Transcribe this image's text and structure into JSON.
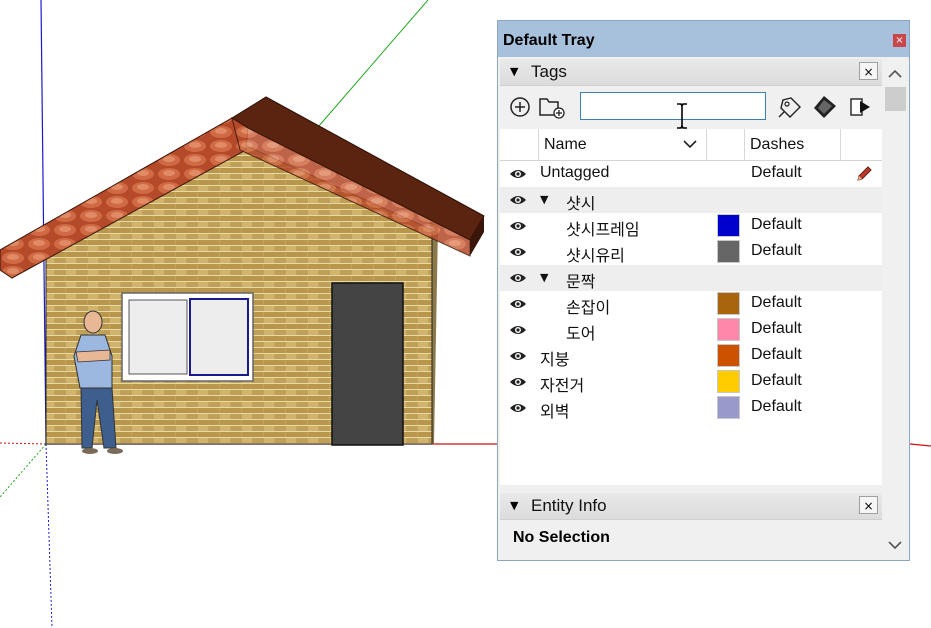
{
  "tray": {
    "title": "Default Tray",
    "close_glyph": "×"
  },
  "tags_panel": {
    "label": "Tags",
    "collapse_glyph": "▼",
    "close_glyph": "×",
    "search": {
      "value": "",
      "placeholder": ""
    },
    "toolbar_icons": [
      "add-tag-icon",
      "add-folder-icon",
      "tag-tool-icon",
      "color-by-tag-icon",
      "details-arrow-icon"
    ],
    "columns": {
      "name": "Name",
      "dashes": "Dashes"
    },
    "rows": [
      {
        "type": "tag",
        "name": "Untagged",
        "dashes": "Default",
        "color": null,
        "active": true
      },
      {
        "type": "folder",
        "name": "샷시",
        "collapse_glyph": "▼"
      },
      {
        "type": "tag",
        "name": "샷시프레임",
        "dashes": "Default",
        "color": "#0000cc"
      },
      {
        "type": "tag",
        "name": "샷시유리",
        "dashes": "Default",
        "color": "#666666"
      },
      {
        "type": "folder",
        "name": "문짝",
        "collapse_glyph": "▼"
      },
      {
        "type": "tag",
        "name": "손잡이",
        "dashes": "Default",
        "color": "#a8650e"
      },
      {
        "type": "tag",
        "name": "도어",
        "dashes": "Default",
        "color": "#ff88aa"
      },
      {
        "type": "tag",
        "name": "지붕",
        "dashes": "Default",
        "color": "#cc5200"
      },
      {
        "type": "tag",
        "name": "자전거",
        "dashes": "Default",
        "color": "#ffcc00"
      },
      {
        "type": "tag",
        "name": "외벽",
        "dashes": "Default",
        "color": "#9999cc"
      }
    ]
  },
  "entity_info": {
    "label": "Entity Info",
    "collapse_glyph": "▼",
    "close_glyph": "×",
    "selection_text": "No Selection"
  },
  "scrollbar": {
    "up_glyph": "︿",
    "down_glyph": "﹀"
  },
  "colors": {
    "tray_title_bg": "#a7c0dc",
    "search_border": "#3c7fb1",
    "axis_red": "#cc0000",
    "axis_green": "#00aa00",
    "axis_blue": "#0000cc",
    "roof": "#5a2410",
    "brick": "#c8a85a",
    "door": "#444444"
  }
}
